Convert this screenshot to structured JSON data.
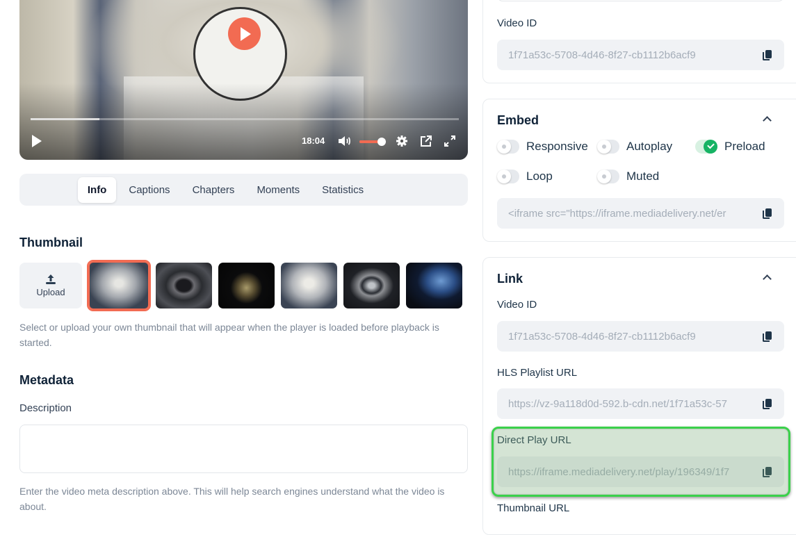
{
  "player": {
    "time": "18:04",
    "progress_fraction": 0.16,
    "volume_fraction": 0.85,
    "icons": [
      "play-icon",
      "volume-icon",
      "settings-gear-icon",
      "external-link-icon",
      "fullscreen-icon"
    ],
    "accent_color": "#f26b52"
  },
  "tabs": [
    {
      "label": "Info",
      "active": true
    },
    {
      "label": "Captions",
      "active": false
    },
    {
      "label": "Chapters",
      "active": false
    },
    {
      "label": "Moments",
      "active": false
    },
    {
      "label": "Statistics",
      "active": false
    }
  ],
  "thumbnail": {
    "title": "Thumbnail",
    "upload_label": "Upload",
    "selected_index": 0,
    "count": 6,
    "help": "Select or upload your own thumbnail that will appear when the player is loaded before playback is started."
  },
  "metadata": {
    "title": "Metadata",
    "description_label": "Description",
    "description_value": "",
    "help": "Enter the video meta description above. This will help search engines understand what the video is about."
  },
  "top_card": {
    "video_id_label": "Video ID",
    "video_id": "1f71a53c-5708-4d46-8f27-cb1112b6acf9"
  },
  "embed": {
    "title": "Embed",
    "toggles": [
      {
        "label": "Responsive",
        "on": false
      },
      {
        "label": "Autoplay",
        "on": false
      },
      {
        "label": "Preload",
        "on": true
      },
      {
        "label": "Loop",
        "on": false
      },
      {
        "label": "Muted",
        "on": false
      }
    ],
    "code": "<iframe src=\"https://iframe.mediadelivery.net/er"
  },
  "link": {
    "title": "Link",
    "video_id_label": "Video ID",
    "video_id": "1f71a53c-5708-4d46-8f27-cb1112b6acf9",
    "hls_label": "HLS Playlist URL",
    "hls_url": "https://vz-9a118d0d-592.b-cdn.net/1f71a53c-57",
    "direct_label": "Direct Play URL",
    "direct_url": "https://iframe.mediadelivery.net/play/196349/1f7",
    "thumbnail_url_label": "Thumbnail URL"
  }
}
